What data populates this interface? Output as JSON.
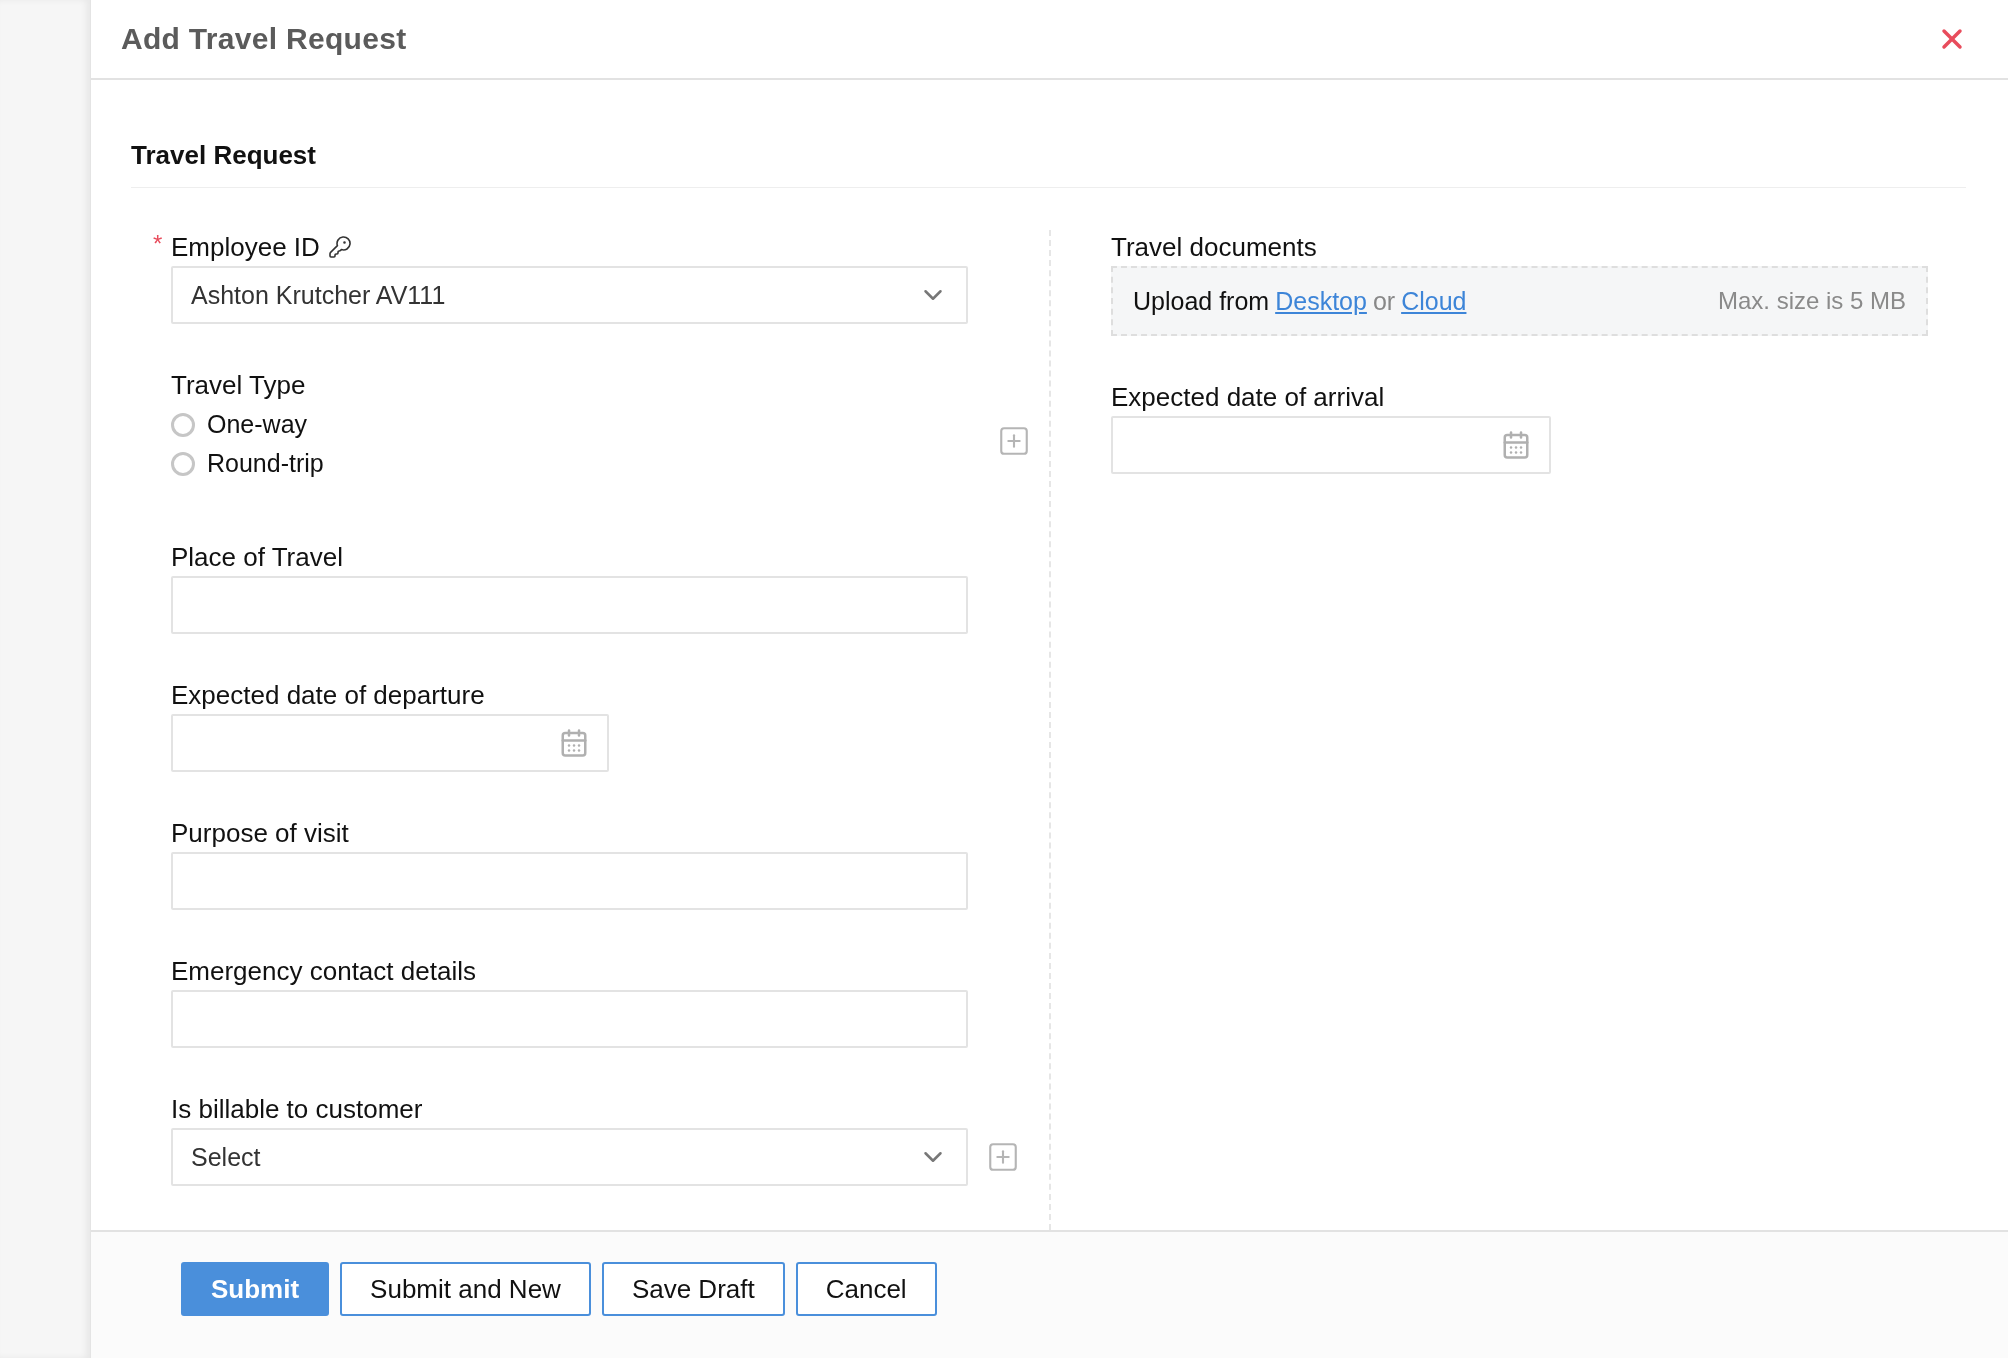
{
  "dialog": {
    "title": "Add Travel Request"
  },
  "section": {
    "title": "Travel Request"
  },
  "left_fields": [
    {
      "kind": "select",
      "label": "Employee ID",
      "required_mark": "*",
      "lookup": true,
      "addable": false,
      "value": "Ashton Krutcher AV111"
    },
    {
      "kind": "radio",
      "label": "Travel Type",
      "lookup": false,
      "addable": true,
      "options": [
        {
          "label": "One-way",
          "selected": false
        },
        {
          "label": "Round-trip",
          "selected": false
        }
      ]
    },
    {
      "kind": "text",
      "label": "Place of Travel",
      "lookup": false,
      "addable": false
    },
    {
      "kind": "date",
      "label": "Expected date of departure",
      "lookup": false,
      "addable": false
    },
    {
      "kind": "text",
      "label": "Purpose of visit",
      "lookup": false,
      "addable": false
    },
    {
      "kind": "text",
      "label": "Emergency contact details",
      "lookup": false,
      "addable": false
    },
    {
      "kind": "select",
      "label": "Is billable to customer",
      "lookup": false,
      "addable": true,
      "value": "Select"
    }
  ],
  "upload": {
    "label": "Travel documents",
    "prefix": "Upload from",
    "links": [
      "Desktop",
      "Cloud"
    ],
    "joiner": "or",
    "note": "Max. size is 5 MB"
  },
  "right_fields": [
    {
      "kind": "date",
      "label": "Expected date of arrival",
      "lookup": false,
      "addable": false
    }
  ],
  "buttons": [
    {
      "label": "Submit",
      "primary": true
    },
    {
      "label": "Submit and New",
      "primary": false
    },
    {
      "label": "Save Draft",
      "primary": false
    },
    {
      "label": "Cancel",
      "primary": false
    }
  ]
}
